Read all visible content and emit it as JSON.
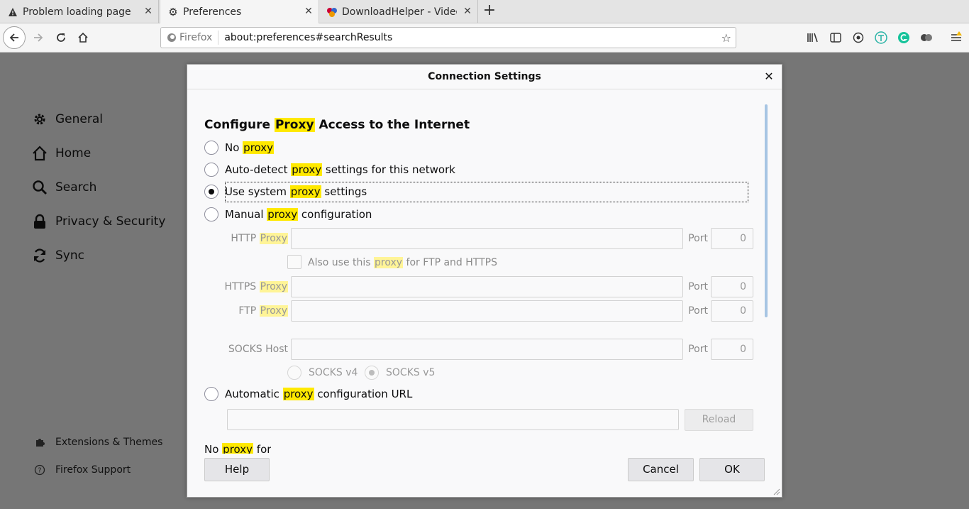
{
  "tabs": [
    {
      "title": "Problem loading page",
      "icon": "warning-icon",
      "close": "✕"
    },
    {
      "title": "Preferences",
      "icon": "gear-icon",
      "close": "✕"
    },
    {
      "title": "DownloadHelper - Video",
      "icon": "downloadhelper-icon",
      "close": "✕"
    }
  ],
  "new_tab": "+",
  "urlbar": {
    "identity": "Firefox",
    "url": "about:preferences#searchResults"
  },
  "sidebar": {
    "items": [
      {
        "label": "General",
        "icon": "gear-icon"
      },
      {
        "label": "Home",
        "icon": "home-icon"
      },
      {
        "label": "Search",
        "icon": "search-icon"
      },
      {
        "label": "Privacy & Security",
        "icon": "lock-icon"
      },
      {
        "label": "Sync",
        "icon": "sync-icon"
      }
    ],
    "footer": [
      {
        "label": "Extensions & Themes",
        "icon": "puzzle-icon"
      },
      {
        "label": "Firefox Support",
        "icon": "help-icon"
      }
    ]
  },
  "dialog": {
    "title": "Connection Settings",
    "close": "✕",
    "heading": {
      "pre": "Configure ",
      "hl": "Proxy",
      "post": " Access to the Internet"
    },
    "options": [
      {
        "pre": "No ",
        "hl": "proxy",
        "post": "",
        "checked": false
      },
      {
        "pre": "Auto-detect ",
        "hl": "proxy",
        "post": " settings for this network",
        "checked": false
      },
      {
        "pre": "Use system ",
        "hl": "proxy",
        "post": " settings",
        "checked": true
      },
      {
        "pre": "Manual ",
        "hl": "proxy",
        "post": " configuration",
        "checked": false
      }
    ],
    "manual": {
      "http_label": "HTTP",
      "https_label": "HTTPS",
      "ftp_label": "FTP",
      "proxy_word": "Proxy",
      "socks_label": "SOCKS Host",
      "port_label": "Port",
      "http_port": "0",
      "https_port": "0",
      "ftp_port": "0",
      "socks_port": "0",
      "also_use": {
        "pre": "Also use this ",
        "hl": "proxy",
        "post": " for FTP and HTTPS"
      },
      "socks_v4": "SOCKS v4",
      "socks_v5": "SOCKS v5",
      "socks_v5_checked": true
    },
    "auto_url": {
      "pre": "Automatic ",
      "hl": "proxy",
      "post": " configuration URL",
      "checked": false
    },
    "reload": "Reload",
    "no_proxy_for": {
      "pre": "No ",
      "hl": "proxy",
      "post": " for"
    },
    "buttons": {
      "help": "Help",
      "cancel": "Cancel",
      "ok": "OK"
    }
  }
}
